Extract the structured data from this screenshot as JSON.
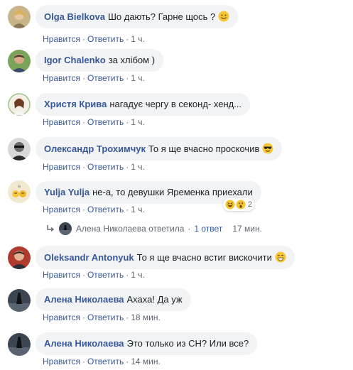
{
  "ui": {
    "like_label": "Нравится",
    "reply_label": "Ответить",
    "separator": "·"
  },
  "comments": [
    {
      "author": "Olga Bielkova",
      "text": "Шо дають? Гарне щось ?",
      "emoji": "smiling-face",
      "time": "1 ч."
    },
    {
      "author": "Igor Chalenko",
      "text": "за хлібом )",
      "time": "1 ч."
    },
    {
      "author": "Христя Крива",
      "text": "нагадує чергу в секонд- хенд...",
      "time": "1 ч."
    },
    {
      "author": "Олександр Трохимчук",
      "text": "То я ще вчасно проскочив",
      "emoji": "sunglasses-face",
      "time": "1 ч."
    },
    {
      "author": "Yulja Yulja",
      "text": "не-а, то девушки Яременка приехали",
      "time": "1 ч.",
      "reactions": {
        "count": "2",
        "icons": [
          "haha-react",
          "wow-react"
        ]
      }
    },
    {
      "author": "Oleksandr Antonyuk",
      "text": "То я ще вчасно встиг вискочити",
      "emoji": "grinning-face",
      "time": "1 ч."
    },
    {
      "author": "Алена Николаева",
      "text": "Ахаха! Да уж",
      "time": "18 мин."
    },
    {
      "author": "Алена Николаева",
      "text": "Это только из СН? Или все?",
      "time": "14 мин."
    }
  ],
  "reply_summary": {
    "text": "Алена Николаева ответила",
    "count_label": "1 ответ",
    "time": "17 мин."
  }
}
